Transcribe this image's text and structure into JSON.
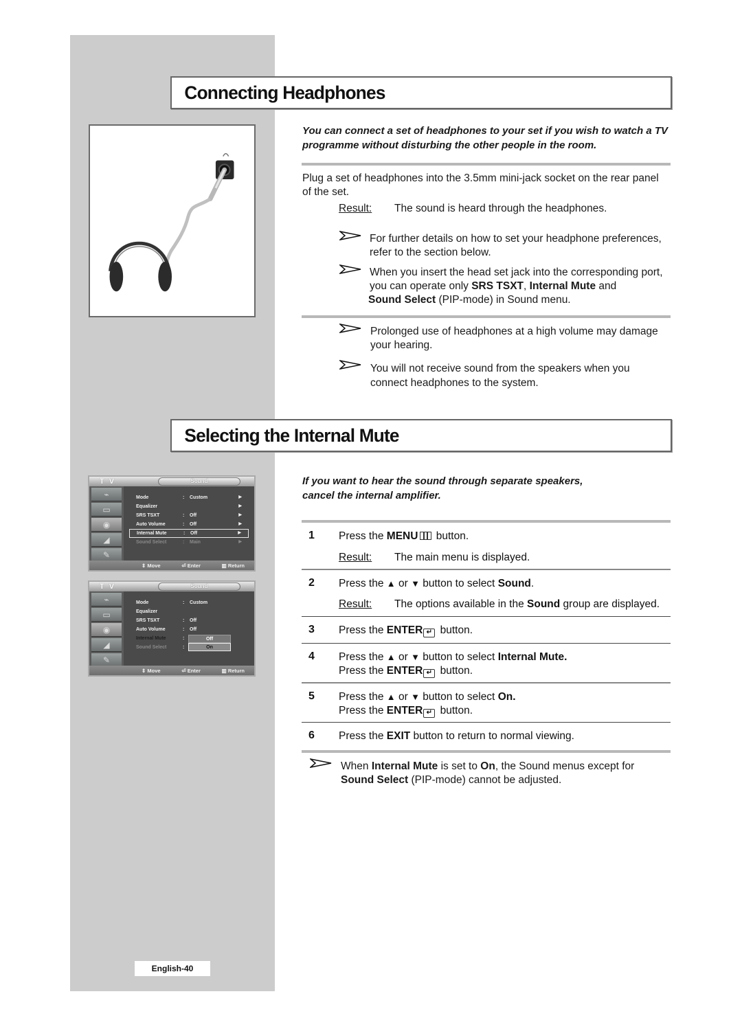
{
  "section1": {
    "title": "Connecting Headphones",
    "intro": "You can connect a set of headphones to your set if you wish to watch a TV programme without disturbing the other people in the room.",
    "body": "Plug a set of headphones into the 3.5mm mini-jack socket on the rear panel of the set.",
    "result_label": "Result:",
    "result_text": "The sound is heard through the headphones.",
    "notes_a": [
      {
        "line1": "For further details on how to set your headphone preferences,",
        "line2": "refer to the section below."
      },
      {
        "line1": "When you insert the head set jack into the corresponding port,",
        "line2_pre": "you can operate only ",
        "line2_b1": "SRS TSXT",
        "line2_mid": ", ",
        "line2_b2": "Internal Mute",
        "line2_post": " and",
        "line3_b": "Sound Select",
        "line3_post": " (PIP-mode) in Sound menu."
      }
    ],
    "notes_b": [
      {
        "line1": "Prolonged use of headphones at a high volume may damage",
        "line2": "your hearing."
      },
      {
        "line1": "You will not receive sound from the speakers when you",
        "line2": "connect headphones to the system."
      }
    ],
    "illustration": "headphones-connected-to-jack"
  },
  "section2": {
    "title": "Selecting the Internal Mute",
    "intro_line1": "If you want to hear the sound through separate speakers,",
    "intro_line2": "cancel the internal amplifier.",
    "steps": [
      {
        "num": "1",
        "pre": "Press the ",
        "bold": "MENU",
        "post": " button.",
        "result_label": "Result:",
        "result_text": "The main menu is displayed."
      },
      {
        "num": "2",
        "pre": "Press the ",
        "up": "▲",
        "or": " or ",
        "down": "▼",
        "mid": " button to select ",
        "bold": "Sound",
        "post": ".",
        "result_label": "Result:",
        "result_pre": "The options available in the ",
        "result_bold": "Sound",
        "result_post": " group are displayed."
      },
      {
        "num": "3",
        "pre": "Press the ",
        "bold": "ENTER",
        "post": " button."
      },
      {
        "num": "4",
        "pre": "Press the ",
        "up": "▲",
        "or": " or ",
        "down": "▼",
        "mid": " button to select ",
        "bold": "Internal Mute.",
        "line2_pre": "Press the ",
        "line2_bold": "ENTER",
        "line2_post": " button."
      },
      {
        "num": "5",
        "pre": "Press the ",
        "up": "▲",
        "or": " or ",
        "down": "▼",
        "mid": " button to select ",
        "bold": "On.",
        "line2_pre": "Press the ",
        "line2_bold": "ENTER",
        "line2_post": " button."
      },
      {
        "num": "6",
        "pre": "Press the ",
        "bold": "EXIT",
        "post": " button to return to normal viewing."
      }
    ],
    "final_note": {
      "pre": "When ",
      "b1": "Internal Mute",
      "mid1": " is set to ",
      "b2": "On",
      "mid2": ", the Sound menus except for",
      "b3": "Sound Select",
      "post": " (PIP-mode) cannot be adjusted."
    }
  },
  "osd": [
    {
      "tv_label": "T V",
      "title": "Sound",
      "rows": [
        {
          "label": "Mode",
          "value": "Custom",
          "arrow": "▶",
          "state": "normal"
        },
        {
          "label": "Equalizer",
          "value": "",
          "arrow": "▶",
          "state": "normal"
        },
        {
          "label": "SRS TSXT",
          "value": "Off",
          "arrow": "▶",
          "state": "normal"
        },
        {
          "label": "Auto Volume",
          "value": "Off",
          "arrow": "▶",
          "state": "normal"
        },
        {
          "label": "Internal Mute",
          "value": "Off",
          "arrow": "▶",
          "state": "selected"
        },
        {
          "label": "Sound Select",
          "value": "Main",
          "arrow": "▶",
          "state": "dim"
        }
      ],
      "footer": {
        "move": "Move",
        "enter": "Enter",
        "return": "Return"
      }
    },
    {
      "tv_label": "T V",
      "title": "Sound",
      "rows": [
        {
          "label": "Mode",
          "value": "Custom",
          "state": "normal"
        },
        {
          "label": "Equalizer",
          "value": "",
          "state": "normal"
        },
        {
          "label": "SRS TSXT",
          "value": "Off",
          "state": "normal"
        },
        {
          "label": "Auto Volume",
          "value": "Off",
          "state": "normal"
        },
        {
          "label": "Internal Mute",
          "value": "",
          "state": "dark"
        },
        {
          "label": "Sound Select",
          "value": "",
          "state": "dim"
        }
      ],
      "popup": {
        "off": "Off",
        "on": "On",
        "selected": "On"
      },
      "footer": {
        "move": "Move",
        "enter": "Enter",
        "return": "Return"
      }
    }
  ],
  "footer": {
    "page": "English-40"
  }
}
